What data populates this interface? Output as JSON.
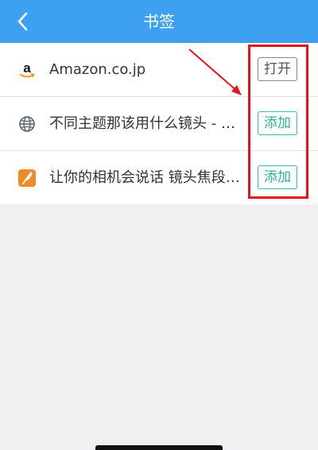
{
  "header": {
    "title": "书签",
    "background_color": "#3ea0f0"
  },
  "bookmarks": [
    {
      "icon": "amazon-logo-icon",
      "title": "Amazon.co.jp",
      "action": "打开"
    },
    {
      "icon": "globe-icon",
      "title": "不同主题那该用什么镜头 - 手…",
      "action": "添加"
    },
    {
      "icon": "orange-feather-app-icon",
      "title": "让你的相机会说话 镜头焦段的…",
      "action": "添加"
    }
  ],
  "annotation": {
    "color": "#e3141b"
  }
}
